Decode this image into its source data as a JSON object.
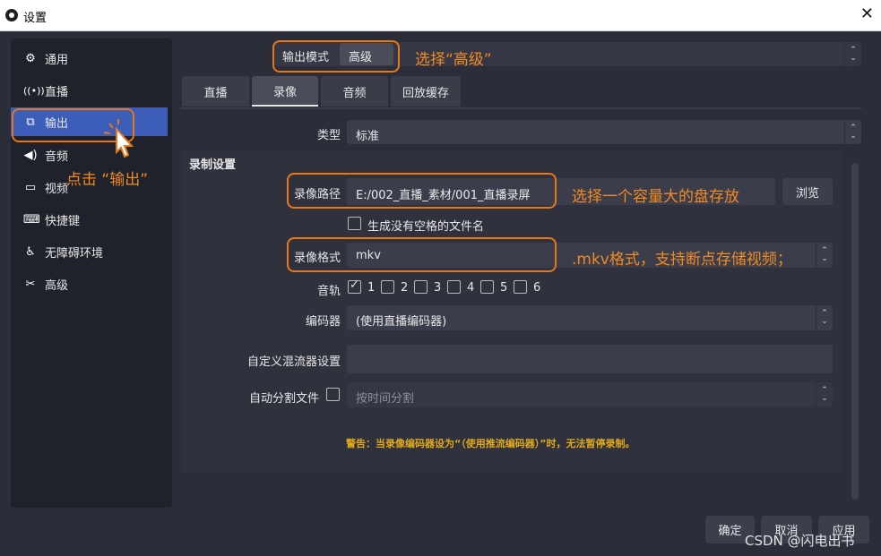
{
  "window": {
    "title": "设置",
    "close_label": "✕"
  },
  "sidebar": {
    "items": [
      {
        "icon": "gear-icon",
        "glyph": "⚙",
        "label": "通用"
      },
      {
        "icon": "antenna-icon",
        "glyph": "📶",
        "label": "直播"
      },
      {
        "icon": "output-icon",
        "glyph": "⧉",
        "label": "输出"
      },
      {
        "icon": "speaker-icon",
        "glyph": "🔊",
        "label": "音频"
      },
      {
        "icon": "monitor-icon",
        "glyph": "▭",
        "label": "视频"
      },
      {
        "icon": "keyboard-icon",
        "glyph": "⌨",
        "label": "快捷键"
      },
      {
        "icon": "accessibility-icon",
        "glyph": "♿",
        "label": "无障碍环境"
      },
      {
        "icon": "tools-icon",
        "glyph": "✂",
        "label": "高级"
      }
    ],
    "active_index": 2
  },
  "output_mode": {
    "label": "输出模式",
    "value": "高级"
  },
  "tabs": [
    {
      "label": "直播"
    },
    {
      "label": "录像"
    },
    {
      "label": "音频"
    },
    {
      "label": "回放缓存"
    }
  ],
  "active_tab": 1,
  "type_row": {
    "label": "类型",
    "value": "标准"
  },
  "recording": {
    "section_title": "录制设置",
    "path_label": "录像路径",
    "path_value": "E:/002_直播_素材/001_直播录屏",
    "browse_label": "浏览",
    "no_space_label": "生成没有空格的文件名",
    "format_label": "录像格式",
    "format_value": "mkv",
    "tracks_label": "音轨",
    "tracks": [
      {
        "num": "1",
        "checked": true
      },
      {
        "num": "2",
        "checked": false
      },
      {
        "num": "3",
        "checked": false
      },
      {
        "num": "4",
        "checked": false
      },
      {
        "num": "5",
        "checked": false
      },
      {
        "num": "6",
        "checked": false
      }
    ],
    "encoder_label": "编码器",
    "encoder_value": "(使用直播编码器)",
    "muxer_label": "自定义混流器设置",
    "muxer_value": "",
    "split_label": "自动分割文件",
    "split_value": "按时间分割",
    "warning": "警告：当录像编码器设为“（使用推流编码器）”时，无法暂停录制。"
  },
  "annotations": {
    "advanced": "选择“高级”",
    "click_output": "点击 “输出”",
    "disk": "选择一个容量大的盘存放",
    "mkv": ".mkv格式，支持断点存储视频；"
  },
  "footer": {
    "ok": "确定",
    "cancel": "取消",
    "apply": "应用"
  },
  "watermark": "CSDN @闪电出书",
  "colors": {
    "accent": "#3c5db8",
    "annotation": "#e8761a",
    "warning": "#e0a81c"
  }
}
